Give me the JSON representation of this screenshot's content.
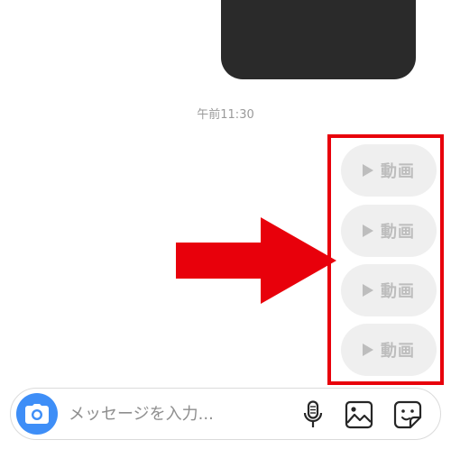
{
  "conversation": {
    "timestamp": "午前11:30",
    "video_messages": [
      {
        "label": "動画",
        "icon": "play-icon"
      },
      {
        "label": "動画",
        "icon": "play-icon"
      },
      {
        "label": "動画",
        "icon": "play-icon"
      },
      {
        "label": "動画",
        "icon": "play-icon"
      }
    ]
  },
  "annotation": {
    "color": "#e8000b",
    "arrow_icon": "right-arrow-icon"
  },
  "composer": {
    "placeholder": "メッセージを入力...",
    "camera_icon": "camera-icon",
    "microphone_icon": "microphone-icon",
    "gallery_icon": "image-icon",
    "sticker_icon": "sticker-icon",
    "accent_color": "#3e8ef7"
  }
}
